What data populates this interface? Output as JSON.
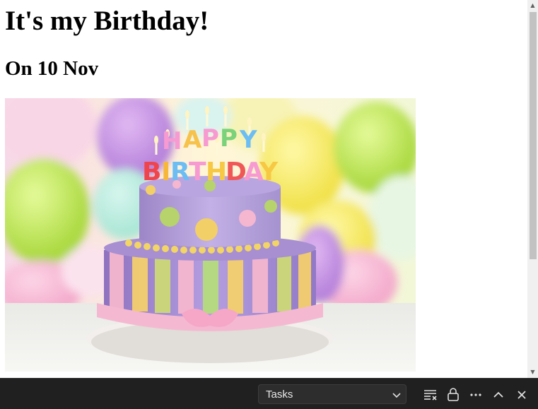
{
  "page": {
    "title": "It's my Birthday!",
    "subtitle": "On 10 Nov"
  },
  "image": {
    "alt_icon": "birthday-cake-photo",
    "candle_letters_top": "HAPPY",
    "candle_letters_bottom": "BIRTHDAY"
  },
  "toolbar": {
    "select_value": "Tasks",
    "icons": [
      "word-wrap-icon",
      "lock-icon",
      "more-icon",
      "chevron-up-icon",
      "close-icon"
    ]
  },
  "colors": {
    "toolbar_bg": "#202020",
    "select_bg": "#2d2d2d",
    "scroll_thumb": "#c2c2c2"
  }
}
